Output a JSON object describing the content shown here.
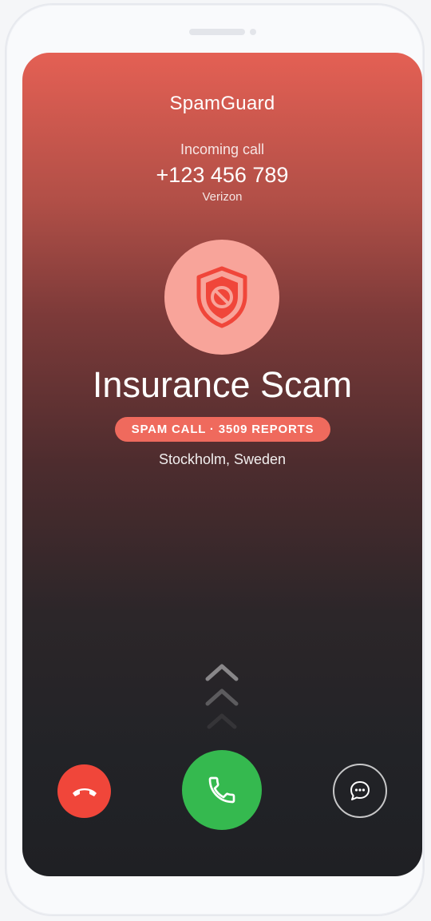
{
  "app": {
    "name": "SpamGuard"
  },
  "call": {
    "status": "Incoming call",
    "number": "+123 456 789",
    "carrier": "Verizon",
    "caller_name": "Insurance Scam",
    "spam_label": "SPAM CALL · 3509 REPORTS",
    "location": "Stockholm, Sweden"
  },
  "icons": {
    "avatar": "shield-block-icon",
    "decline": "phone-hangup-icon",
    "accept": "phone-icon",
    "message": "message-bubble-icon",
    "swipe": "chevron-up-icon"
  },
  "colors": {
    "gradient_top": "#e46054",
    "gradient_bottom": "#1f2024",
    "spam_accent": "#ef6a5d",
    "avatar_bg": "#f8a49a",
    "shield": "#f0463a",
    "decline": "#f0463a",
    "accept": "#35b94f"
  }
}
